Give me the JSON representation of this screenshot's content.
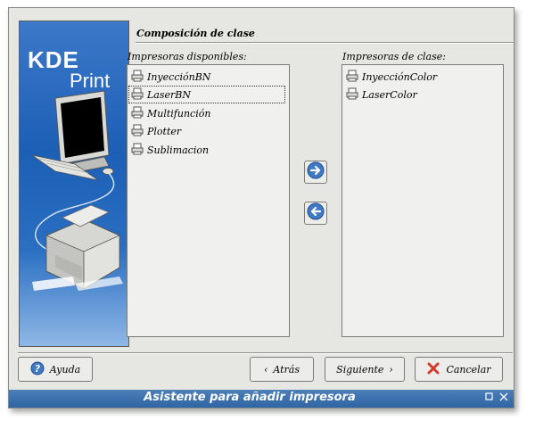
{
  "window": {
    "title": "Asistente para añadir impresora",
    "page_title": "Composición de clase"
  },
  "logo": {
    "kde": "KDE",
    "print": "Print"
  },
  "available": {
    "label": "Impresoras disponibles:",
    "items": [
      "InyecciónBN",
      "LaserBN",
      "Multifunción",
      "Plotter",
      "Sublimacion"
    ]
  },
  "class_printers": {
    "label": "Impresoras de clase:",
    "items": [
      "InyecciónColor",
      "LaserColor"
    ]
  },
  "buttons": {
    "help": "Ayuda",
    "back_arrow": "‹",
    "back": "Atrás",
    "next": "Siguiente",
    "next_arrow": "›",
    "cancel": "Cancelar"
  },
  "colors": {
    "arrow_blue": "#3f78c4",
    "cancel_red": "#d23a2a"
  }
}
